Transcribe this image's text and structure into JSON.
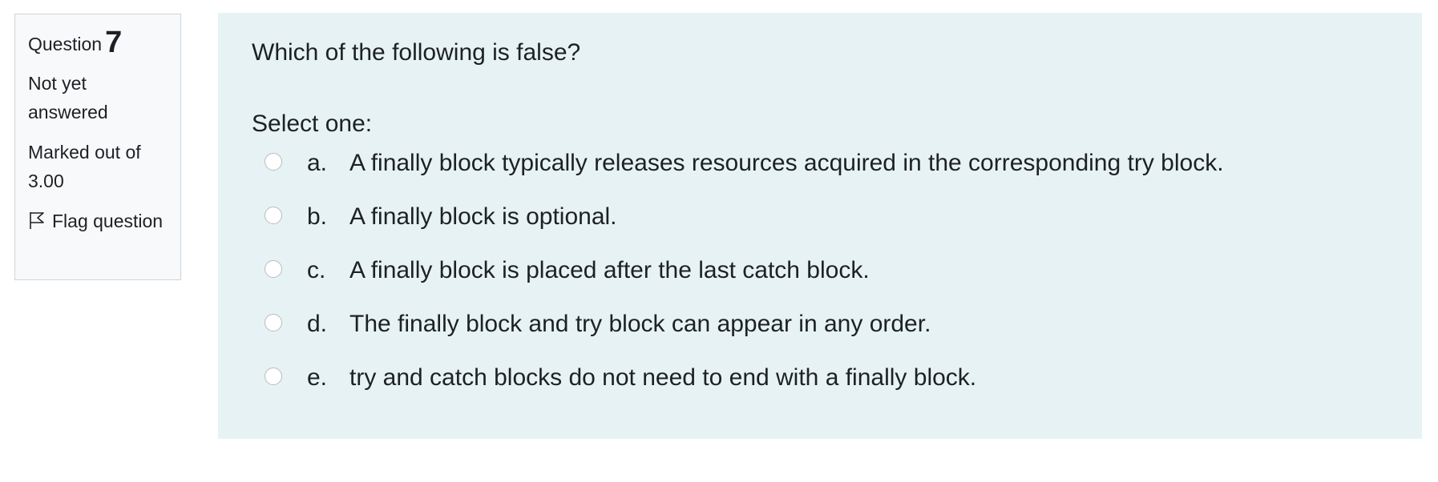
{
  "info": {
    "question_word": "Question",
    "question_number": "7",
    "state": "Not yet answered",
    "grade": "Marked out of 3.00",
    "flag_label": "Flag question"
  },
  "question": {
    "text": "Which of the following is false?",
    "prompt": "Select one:",
    "answers": [
      {
        "letter": "a.",
        "text": "A finally block typically releases resources acquired in the corresponding try block."
      },
      {
        "letter": "b.",
        "text": "A finally block is optional."
      },
      {
        "letter": "c.",
        "text": "A finally block is placed after the last catch block."
      },
      {
        "letter": "d.",
        "text": "The finally block and try block can appear in any order."
      },
      {
        "letter": "e.",
        "text": "try and catch blocks do not need to end with a finally block."
      }
    ]
  },
  "icons": {
    "flag": "flag-icon",
    "radio": "radio-button-icon"
  },
  "colors": {
    "content_background": "#e7f2f4",
    "info_background": "#f8f9fa",
    "info_border": "#cfd4da",
    "text": "#1d2125"
  }
}
